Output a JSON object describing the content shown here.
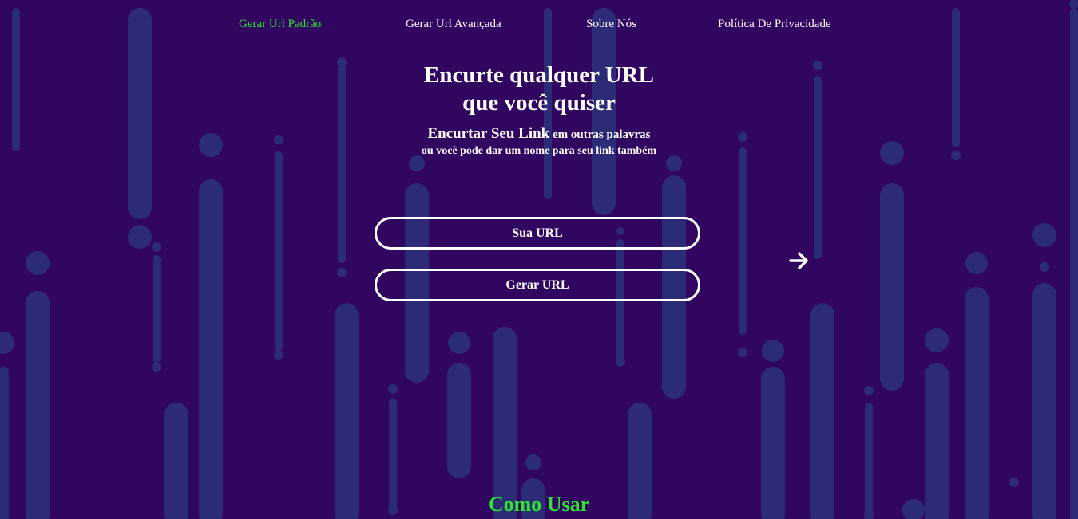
{
  "nav": {
    "items": [
      {
        "label": "Gerar Url Padrão",
        "active": true
      },
      {
        "label": "Gerar Url Avançada",
        "active": false
      },
      {
        "label": "Sobre Nós",
        "active": false
      },
      {
        "label": "Política De Privacidade",
        "active": false
      }
    ]
  },
  "hero": {
    "title_line1": "Encurte qualquer URL",
    "title_line2": "que você quiser",
    "subtitle_big": "Encurtar Seu Link",
    "subtitle_small": " em outras palavras",
    "subtitle_line2": "ou você pode dar um nome para seu link também"
  },
  "form": {
    "url_placeholder": "Sua URL",
    "generate_label": "Gerar URL",
    "submit_icon": "arrow-right-icon"
  },
  "how_to": {
    "title": "Como Usar"
  },
  "colors": {
    "background": "#300660",
    "shape": "#2c2b78",
    "accent_green": "#2de52f",
    "text": "#ffffff"
  }
}
